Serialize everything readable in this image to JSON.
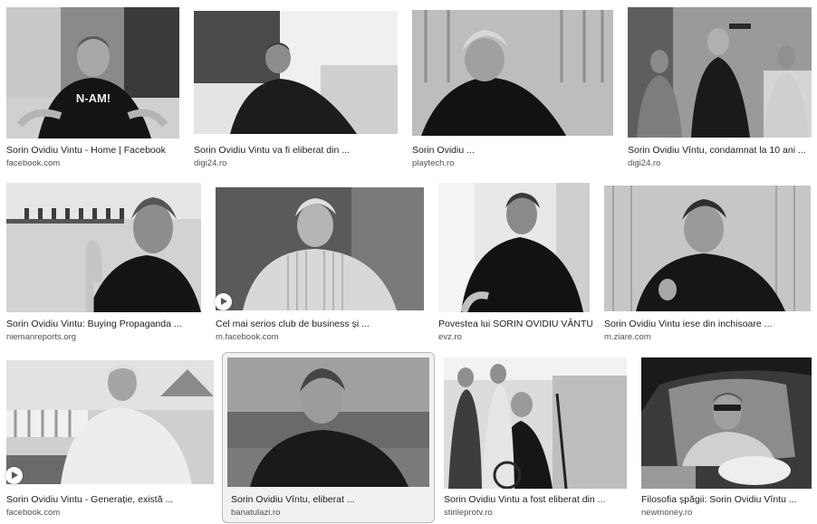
{
  "results": [
    {
      "title": "Sorin Ovidiu Vintu - Home | Facebook",
      "source": "facebook.com",
      "icon": "photo",
      "shirt_text": "N-AM!"
    },
    {
      "title": "Sorin Ovidiu Vintu va fi eliberat din ...",
      "source": "digi24.ro",
      "icon": "photo"
    },
    {
      "title": "Sorin Ovidiu ...",
      "source": "playtech.ro",
      "icon": "photo"
    },
    {
      "title": "Sorin Ovidiu Vîntu, condamnat la 10 ani ...",
      "source": "digi24.ro",
      "icon": "photo"
    },
    {
      "title": "Sorin Ovidiu Vintu: Buying Propaganda ...",
      "source": "niemanreports.org",
      "icon": "photo"
    },
    {
      "title": "Cel mai serios club de business și ...",
      "source": "m.facebook.com",
      "icon": "play-video-icon"
    },
    {
      "title": "Povestea lui SORIN OVIDIU VÂNTU...",
      "source": "evz.ro",
      "icon": "photo"
    },
    {
      "title": "Sorin Ovidiu Vintu iese din inchisoare ...",
      "source": "m.ziare.com",
      "icon": "photo"
    },
    {
      "title": "Sorin Ovidiu Vintu - Generație, există ...",
      "source": "facebook.com",
      "icon": "play-video-icon"
    },
    {
      "title": "Sorin Ovidiu Vîntu, eliberat ...",
      "source": "banatulazi.ro",
      "icon": "photo",
      "selected": true
    },
    {
      "title": "Sorin Ovidiu Vintu a fost eliberat din ...",
      "source": "stirileprotv.ro",
      "icon": "photo"
    },
    {
      "title": "Filosofia șpăgii: Sorin Ovidiu Vîntu ...",
      "source": "newmoney.ro",
      "icon": "photo"
    }
  ]
}
